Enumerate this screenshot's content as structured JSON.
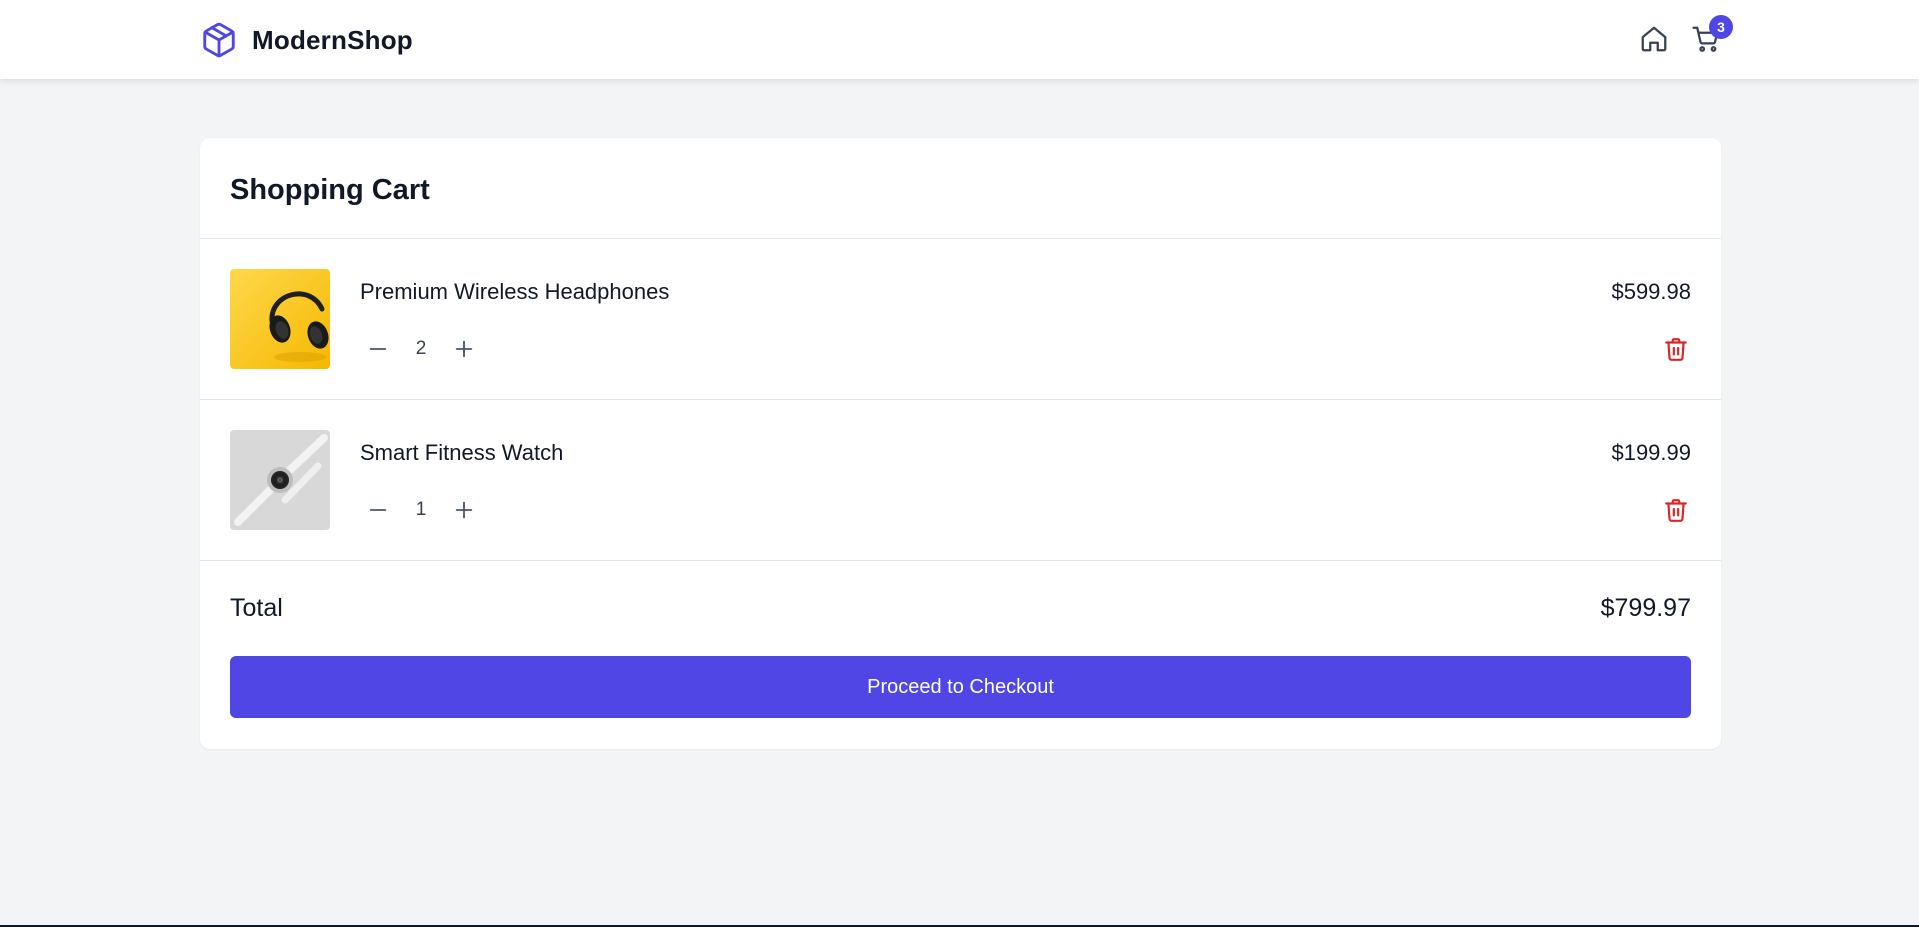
{
  "header": {
    "brand_name": "ModernShop",
    "brand_icon": "box-icon",
    "home_icon": "home-icon",
    "cart_icon": "shopping-cart-icon",
    "cart_count": "3"
  },
  "cart": {
    "title": "Shopping Cart",
    "items": [
      {
        "name": "Premium Wireless Headphones",
        "quantity": "2",
        "price": "$599.98",
        "image": "headphones-on-yellow"
      },
      {
        "name": "Smart Fitness Watch",
        "quantity": "1",
        "price": "$199.99",
        "image": "white-smartwatch"
      }
    ],
    "total_label": "Total",
    "total_value": "$799.97",
    "checkout_label": "Proceed to Checkout"
  },
  "colors": {
    "accent": "#4f46e5",
    "delete": "#dc2626",
    "background": "#f3f4f6"
  }
}
